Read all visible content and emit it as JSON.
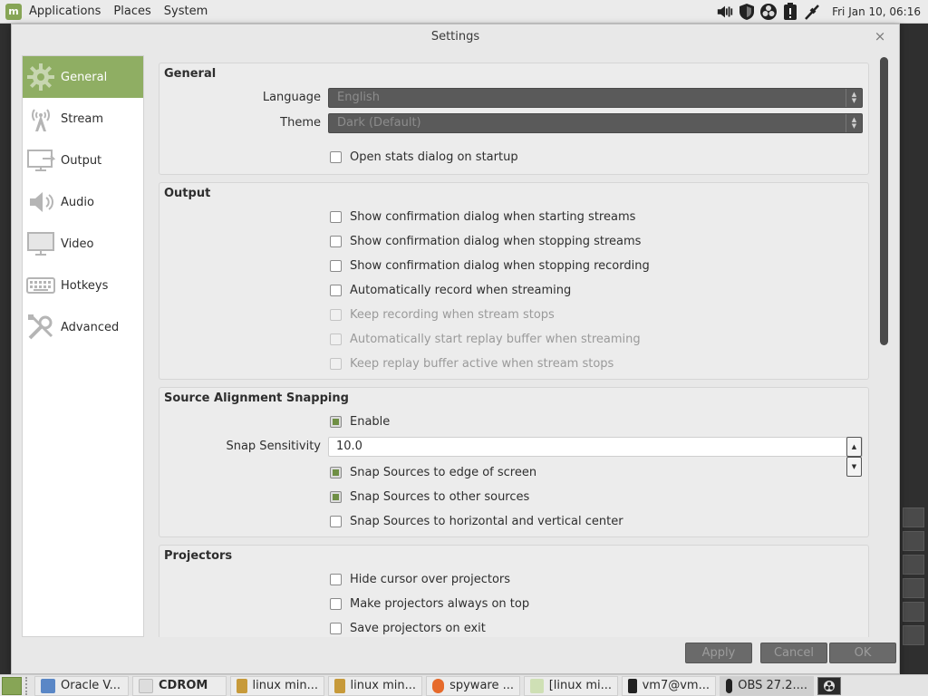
{
  "top_panel": {
    "menus": [
      "Applications",
      "Places",
      "System"
    ],
    "clock": "Fri Jan 10, 06:16"
  },
  "dialog": {
    "title": "Settings",
    "close": "×",
    "sidebar": [
      {
        "label": "General",
        "icon": "gear-icon",
        "active": true
      },
      {
        "label": "Stream",
        "icon": "antenna-icon"
      },
      {
        "label": "Output",
        "icon": "monitor-out-icon"
      },
      {
        "label": "Audio",
        "icon": "speaker-icon"
      },
      {
        "label": "Video",
        "icon": "monitor-icon"
      },
      {
        "label": "Hotkeys",
        "icon": "keyboard-icon"
      },
      {
        "label": "Advanced",
        "icon": "tools-icon"
      }
    ],
    "general": {
      "title": "General",
      "language_label": "Language",
      "language_value": "English",
      "theme_label": "Theme",
      "theme_value": "Dark (Default)",
      "open_stats": "Open stats dialog on startup"
    },
    "output": {
      "title": "Output",
      "items": [
        {
          "label": "Show confirmation dialog when starting streams",
          "checked": false,
          "disabled": false
        },
        {
          "label": "Show confirmation dialog when stopping streams",
          "checked": false,
          "disabled": false
        },
        {
          "label": "Show confirmation dialog when stopping recording",
          "checked": false,
          "disabled": false
        },
        {
          "label": "Automatically record when streaming",
          "checked": false,
          "disabled": false
        },
        {
          "label": "Keep recording when stream stops",
          "checked": false,
          "disabled": true
        },
        {
          "label": "Automatically start replay buffer when streaming",
          "checked": false,
          "disabled": true
        },
        {
          "label": "Keep replay buffer active when stream stops",
          "checked": false,
          "disabled": true
        }
      ]
    },
    "snapping": {
      "title": "Source Alignment Snapping",
      "enable": "Enable",
      "sensitivity_label": "Snap Sensitivity",
      "sensitivity_value": "10.0",
      "edge": "Snap Sources to edge of screen",
      "other": "Snap Sources to other sources",
      "center": "Snap Sources to horizontal and vertical center"
    },
    "projectors": {
      "title": "Projectors",
      "hide_cursor": "Hide cursor over projectors",
      "always_top": "Make projectors always on top",
      "save_exit": "Save projectors on exit"
    },
    "buttons": {
      "apply": "Apply",
      "cancel": "Cancel",
      "ok": "OK"
    }
  },
  "taskbar": {
    "tasks": [
      "Oracle V...",
      "CDROM",
      "linux min...",
      "linux min...",
      "spyware ...",
      "[linux mi...",
      "vm7@vm...",
      "OBS 27.2...."
    ]
  },
  "colors": {
    "accent": "#8fae63",
    "checkmark": "#6f8f44"
  }
}
